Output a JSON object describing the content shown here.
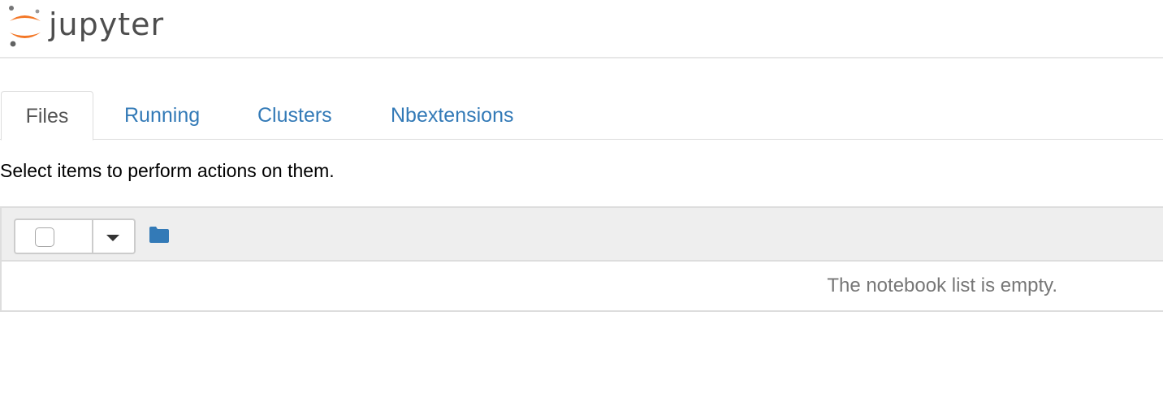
{
  "header": {
    "logo_text": "jupyter"
  },
  "tabs": [
    {
      "label": "Files",
      "active": true
    },
    {
      "label": "Running",
      "active": false
    },
    {
      "label": "Clusters",
      "active": false
    },
    {
      "label": "Nbextensions",
      "active": false
    }
  ],
  "instructions": "Select items to perform actions on them.",
  "toolbar": {
    "select_all_checked": false,
    "dropdown_icon": "caret-down-icon",
    "folder_icon": "folder-icon"
  },
  "notebook_list": {
    "empty_message": "The notebook list is empty."
  },
  "colors": {
    "link": "#337ab7",
    "logo_orange": "#f37726",
    "header_bg": "#eeeeee"
  }
}
